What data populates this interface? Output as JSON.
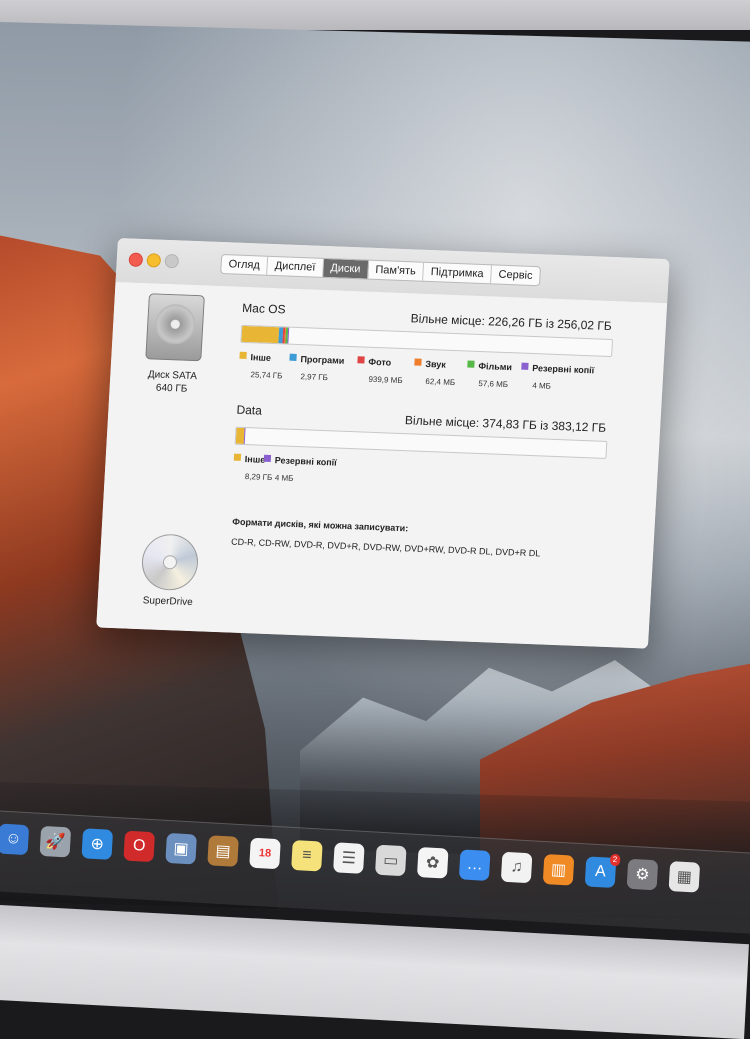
{
  "window": {
    "tabs": [
      {
        "label": "Огляд",
        "active": false
      },
      {
        "label": "Дисплеї",
        "active": false
      },
      {
        "label": "Диски",
        "active": true
      },
      {
        "label": "Пам'ять",
        "active": false
      },
      {
        "label": "Підтримка",
        "active": false
      },
      {
        "label": "Сервіс",
        "active": false
      }
    ]
  },
  "disk": {
    "name": "Диск SATA",
    "size": "640 ГБ",
    "icon": "hard-disk-icon"
  },
  "volumes": [
    {
      "name": "Mac OS",
      "free_text": "Вільне місце: 226,26 ГБ із 256,02 ГБ",
      "usage_fraction_segments": [
        {
          "label": "Інше",
          "fraction": 0.1005,
          "color": "#e8b634"
        },
        {
          "label": "Програми",
          "fraction": 0.0116,
          "color": "#3d9bd6"
        },
        {
          "label": "Фото",
          "fraction": 0.0037,
          "color": "#e04545"
        },
        {
          "label": "Звук",
          "fraction": 0.0004,
          "color": "#ef7e2a"
        },
        {
          "label": "Фільми",
          "fraction": 0.0004,
          "color": "#56b846"
        },
        {
          "label": "Резервні копії",
          "fraction": 0.0001,
          "color": "#8a5fd0"
        }
      ],
      "legend": [
        {
          "label": "Інше",
          "size": "25,74 ГБ",
          "color": "#e8b634"
        },
        {
          "label": "Програми",
          "size": "2,97 ГБ",
          "color": "#3d9bd6"
        },
        {
          "label": "Фото",
          "size": "939,9 МБ",
          "color": "#e04545"
        },
        {
          "label": "Звук",
          "size": "62,4 МБ",
          "color": "#ef7e2a"
        },
        {
          "label": "Фільми",
          "size": "57,6 МБ",
          "color": "#56b846"
        },
        {
          "label": "Резервні копії",
          "size": "4 МБ",
          "color": "#8a5fd0"
        }
      ]
    },
    {
      "name": "Data",
      "free_text": "Вільне місце: 374,83 ГБ із 383,12 ГБ",
      "usage_fraction_segments": [
        {
          "label": "Інше",
          "fraction": 0.0216,
          "color": "#e8b634"
        },
        {
          "label": "Резервні копії",
          "fraction": 0.0001,
          "color": "#8a5fd0"
        }
      ],
      "legend": [
        {
          "label": "Інше",
          "size": "8,29 ГБ",
          "color": "#e8b634"
        },
        {
          "label": "Резервні копії",
          "size": "4 МБ",
          "color": "#8a5fd0"
        }
      ]
    }
  ],
  "optical": {
    "name": "SuperDrive",
    "icon": "optical-disc-icon",
    "formats_title": "Формати дисків, які можна записувати:",
    "formats": "CD-R, CD-RW, DVD-R, DVD+R, DVD-RW, DVD+RW, DVD-R DL, DVD+R DL"
  },
  "dock": {
    "items": [
      {
        "name": "finder-icon",
        "glyph": "☺",
        "color": "#3a7bd5"
      },
      {
        "name": "launchpad-icon",
        "glyph": "🚀",
        "color": "#9aa3ab"
      },
      {
        "name": "safari-icon",
        "glyph": "⊕",
        "color": "#2f8ae0"
      },
      {
        "name": "opera-icon",
        "glyph": "O",
        "color": "#d12a2a"
      },
      {
        "name": "preview-icon",
        "glyph": "▣",
        "color": "#6b8fbf"
      },
      {
        "name": "contacts-icon",
        "glyph": "▤",
        "color": "#b07a3a"
      },
      {
        "name": "calendar-icon",
        "glyph": "18",
        "color": "#f4f4f4"
      },
      {
        "name": "notes-icon",
        "glyph": "≡",
        "color": "#f5e27a"
      },
      {
        "name": "reminders-icon",
        "glyph": "☰",
        "color": "#f2f2f2"
      },
      {
        "name": "keynote-icon",
        "glyph": "▭",
        "color": "#d9d9d9"
      },
      {
        "name": "photos-icon",
        "glyph": "✿",
        "color": "#f5f5f5"
      },
      {
        "name": "messages-icon",
        "glyph": "…",
        "color": "#3b8df0"
      },
      {
        "name": "itunes-icon",
        "glyph": "♫",
        "color": "#f2f2f2"
      },
      {
        "name": "ibooks-icon",
        "glyph": "▥",
        "color": "#ef8a25"
      },
      {
        "name": "app-store-icon",
        "glyph": "A",
        "color": "#2f8ae0",
        "badge": "2"
      },
      {
        "name": "system-preferences-icon",
        "glyph": "⚙",
        "color": "#7b7b80"
      },
      {
        "name": "screenshot-icon",
        "glyph": "▦",
        "color": "#e6e6e6"
      }
    ],
    "calendar_day": "18"
  }
}
